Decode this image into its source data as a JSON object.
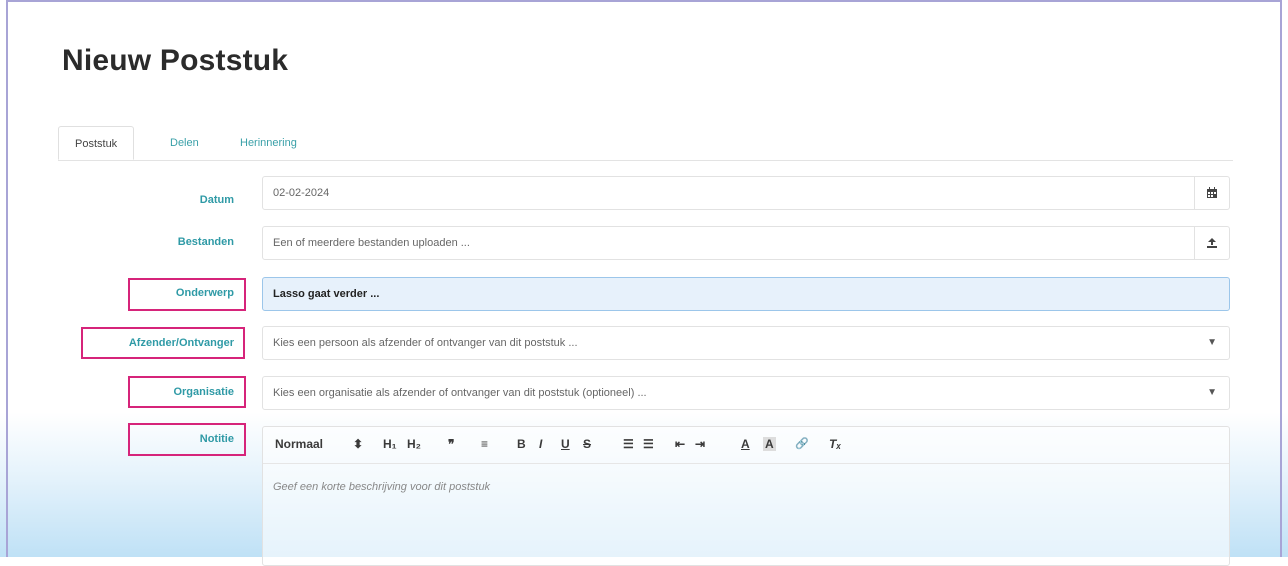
{
  "page": {
    "title": "Nieuw Poststuk"
  },
  "tabs": [
    {
      "label": "Poststuk",
      "active": true
    },
    {
      "label": "Delen",
      "active": false
    },
    {
      "label": "Herinnering",
      "active": false
    }
  ],
  "form": {
    "datum": {
      "label": "Datum",
      "value": "02-02-2024",
      "icon": "calendar-icon"
    },
    "bestanden": {
      "label": "Bestanden",
      "placeholder": "Een of meerdere bestanden uploaden ...",
      "icon": "upload-icon"
    },
    "onderwerp": {
      "label": "Onderwerp",
      "value": "Lasso gaat verder ..."
    },
    "afzender": {
      "label": "Afzender/Ontvanger",
      "placeholder": "Kies een persoon als afzender of ontvanger van dit poststuk ..."
    },
    "organisatie": {
      "label": "Organisatie",
      "placeholder": "Kies een organisatie als afzender of ontvanger van dit poststuk (optioneel) ..."
    },
    "notitie": {
      "label": "Notitie",
      "placeholder": "Geef een korte beschrijving voor dit poststuk"
    }
  },
  "editor_toolbar": {
    "format_label": "Normaal",
    "format_arrow": "⬍",
    "h1": "H₁",
    "h2": "H₂",
    "quote": "❞",
    "align": "≡",
    "bold": "B",
    "italic": "I",
    "underline": "U",
    "strike": "S",
    "ordered_list": "☰",
    "bullet_list": "☰",
    "indent_less": "⇤",
    "indent_more": "⇥",
    "text_color": "A",
    "background_color": "A",
    "link": "🔗",
    "clear_format": "Tₓ"
  },
  "colors": {
    "label_teal": "#2f9aa6",
    "highlight_pink": "#d6247a",
    "focus_bg": "#e7f1fb"
  }
}
